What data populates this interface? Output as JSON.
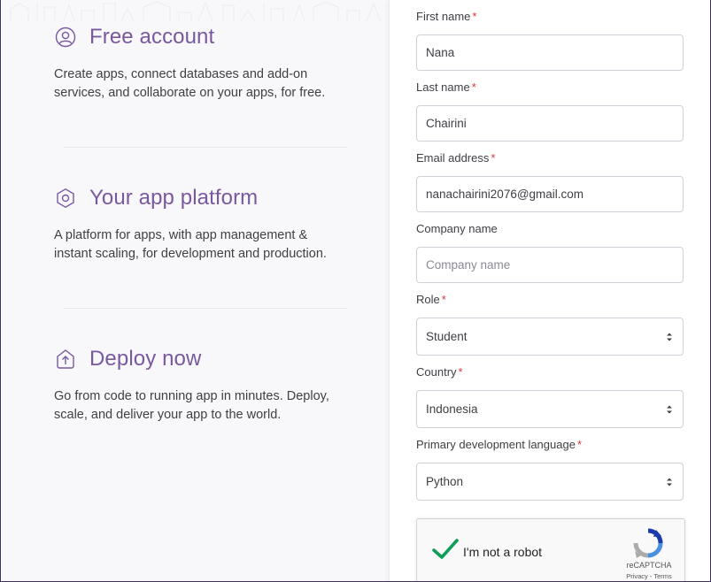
{
  "features": [
    {
      "title": "Free account",
      "icon": "user-circle-icon",
      "desc": "Create apps, connect databases and add-on services, and collaborate on your apps, for free."
    },
    {
      "title": "Your app platform",
      "icon": "hexagon-icon",
      "desc": "A platform for apps, with app management & instant scaling, for development and production."
    },
    {
      "title": "Deploy now",
      "icon": "upload-icon",
      "desc": "Go from code to running app in minutes. Deploy, scale, and deliver your app to the world."
    }
  ],
  "form": {
    "required_mark": "*",
    "first_name": {
      "label": "First name",
      "value": "Nana"
    },
    "last_name": {
      "label": "Last name",
      "value": "Chairini"
    },
    "email": {
      "label": "Email address",
      "value": "nanachairini2076@gmail.com"
    },
    "company": {
      "label": "Company name",
      "placeholder": "Company name"
    },
    "role": {
      "label": "Role",
      "value": "Student"
    },
    "country": {
      "label": "Country",
      "value": "Indonesia"
    },
    "language": {
      "label": "Primary development language",
      "value": "Python"
    }
  },
  "captcha": {
    "label": "I'm not a robot",
    "brand": "reCAPTCHA",
    "links": "Privacy - Terms",
    "checked": true
  },
  "colors": {
    "accent": "#79589f",
    "required": "#d6373f",
    "check": "#0f9d58"
  }
}
